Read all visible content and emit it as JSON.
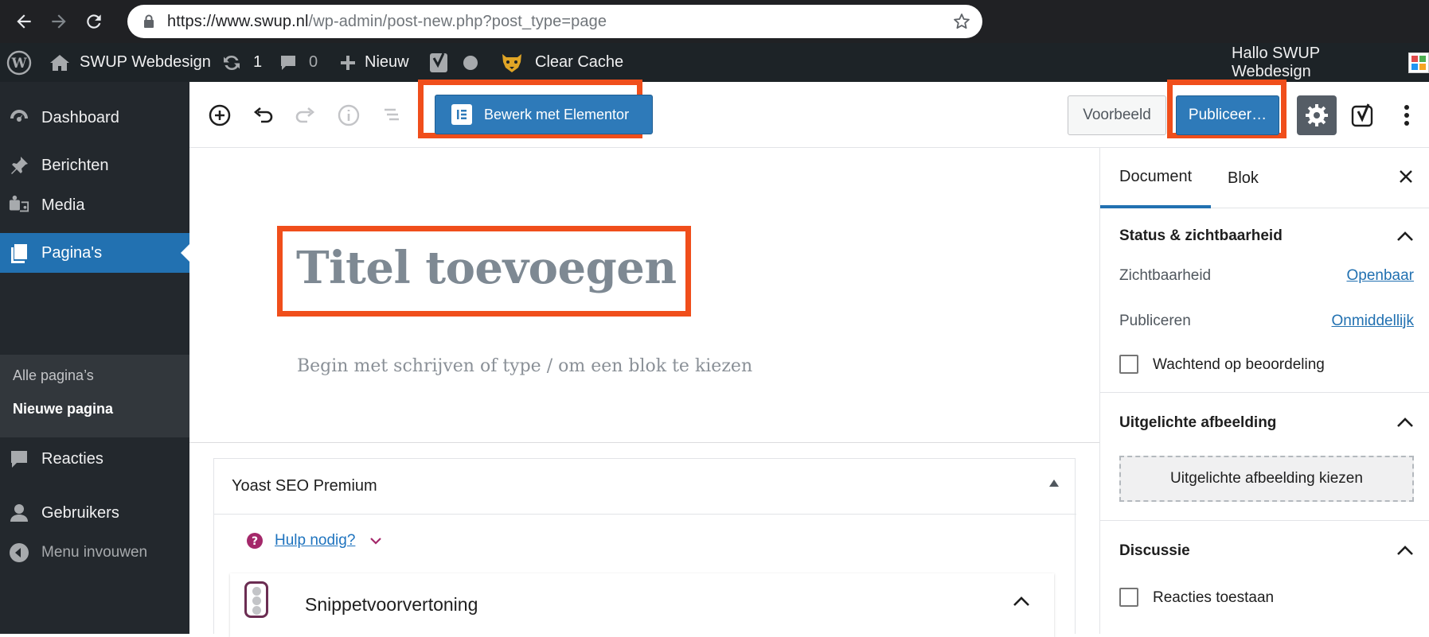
{
  "browser": {
    "url_host": "https://www.swup.nl",
    "url_path": "/wp-admin/post-new.php?post_type=page"
  },
  "adminbar": {
    "site_name": "SWUP Webdesign",
    "updates_count": "1",
    "comments_count": "0",
    "new_label": "Nieuw",
    "clear_cache_label": "Clear Cache",
    "greeting": "Hallo SWUP Webdesign"
  },
  "menu": {
    "items": [
      {
        "label": "Dashboard",
        "icon": "dashboard-icon"
      },
      {
        "label": "Berichten",
        "icon": "pin-icon"
      },
      {
        "label": "Media",
        "icon": "media-icon"
      },
      {
        "label": "Pagina's",
        "icon": "pages-icon"
      },
      {
        "label": "Reacties",
        "icon": "comments-icon"
      },
      {
        "label": "Gebruikers",
        "icon": "users-icon"
      },
      {
        "label": "Menu invouwen",
        "icon": "collapse-icon"
      }
    ],
    "submenu": [
      "Alle pagina’s",
      "Nieuwe pagina"
    ]
  },
  "header": {
    "elementor_label": "Bewerk met Elementor",
    "preview_label": "Voorbeeld",
    "publish_label": "Publiceer…"
  },
  "editor": {
    "title_placeholder": "Titel toevoegen",
    "appender_placeholder": "Begin met schrijven of type / om een blok te kiezen"
  },
  "yoast": {
    "panel_title": "Yoast SEO Premium",
    "help_label": "Hulp nodig?",
    "snippet_label": "Snippetvoorvertoning"
  },
  "sidebar": {
    "tabs": [
      "Document",
      "Blok"
    ],
    "status_title": "Status & zichtbaarheid",
    "visibility_label": "Zichtbaarheid",
    "visibility_value": "Openbaar",
    "publish_label": "Publiceren",
    "publish_value": "Onmiddellijk",
    "pending_label": "Wachtend op beoordeling",
    "featured_title": "Uitgelichte afbeelding",
    "featured_button": "Uitgelichte afbeelding kiezen",
    "discussion_title": "Discussie",
    "comments_label": "Reacties toestaan"
  },
  "colors": {
    "highlight": "#f04e1b",
    "primary_button": "#2e7ab9",
    "admin_bar": "#1d2327",
    "menu_bg": "#23282d",
    "menu_current": "#2271b1"
  }
}
